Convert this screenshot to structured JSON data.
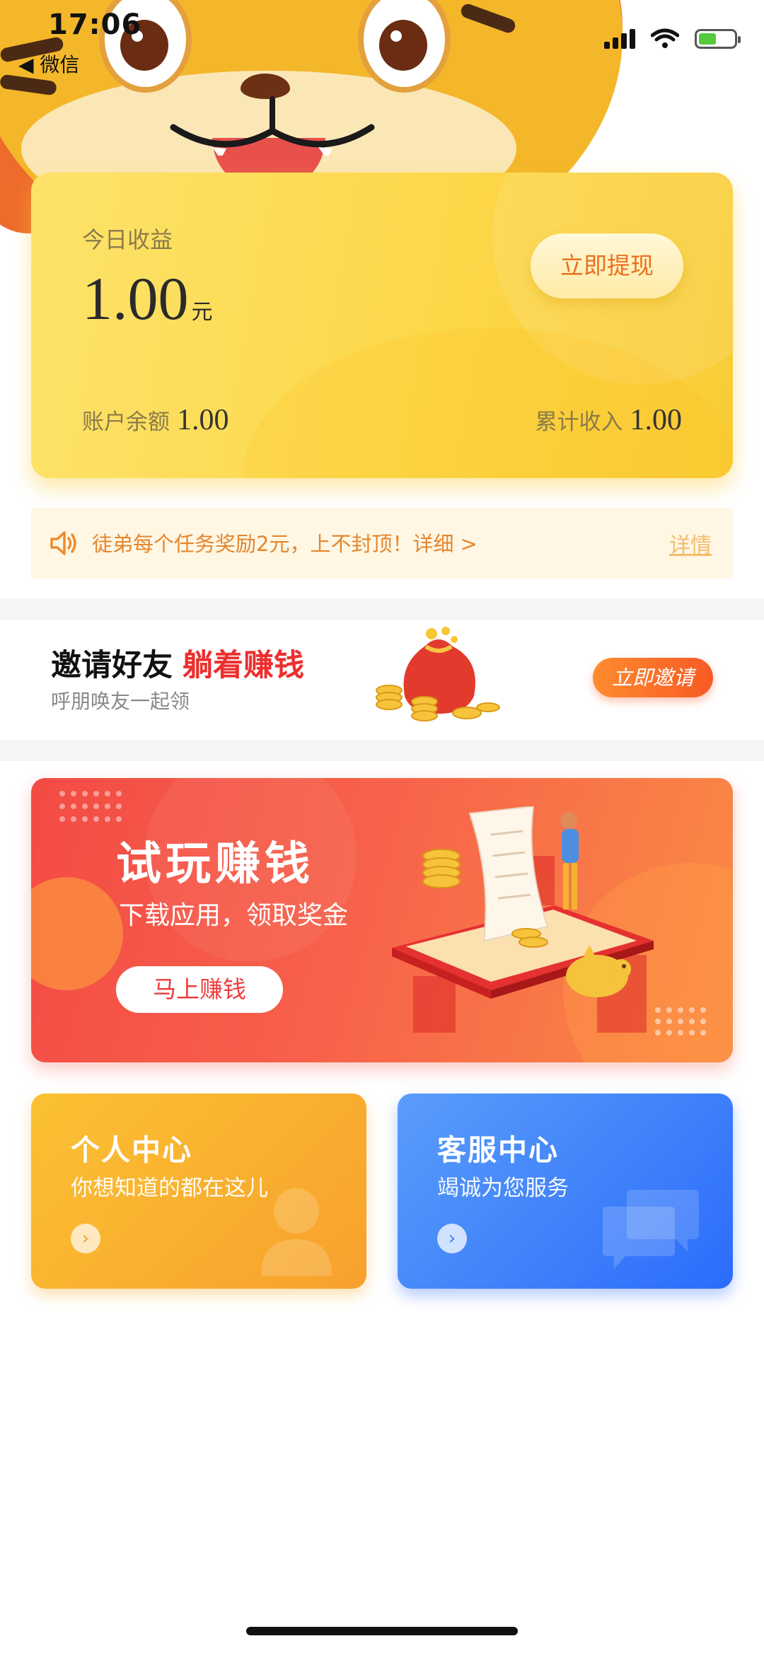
{
  "status_bar": {
    "time": "17:06",
    "back_label": "◀ 微信"
  },
  "earnings": {
    "today_label": "今日收益",
    "today_amount": "1.00",
    "currency_unit": "元",
    "withdraw_button": "立即提现",
    "balance_label": "账户余额",
    "balance_value": "1.00",
    "total_label": "累计收入",
    "total_value": "1.00"
  },
  "notice": {
    "icon": "speaker-icon",
    "text": "徒弟每个任务奖励2元，上不封顶！详细 >",
    "link": "详情"
  },
  "invite": {
    "title": "邀请好友",
    "highlight": "躺着赚钱",
    "subtitle": "呼朋唤友一起领",
    "button": "立即邀请"
  },
  "trial": {
    "title": "试玩赚钱",
    "subtitle": "下载应用，领取奖金",
    "button": "马上赚钱"
  },
  "personal_center": {
    "title": "个人中心",
    "subtitle": "你想知道的都在这儿",
    "icon": "user-icon"
  },
  "service_center": {
    "title": "客服中心",
    "subtitle": "竭诚为您服务",
    "icon": "chat-bubbles-icon"
  },
  "colors": {
    "accent_yellow": "#fcd84a",
    "accent_red": "#ed2f2f",
    "accent_orange": "#f75a24",
    "accent_blue": "#2b6cfb"
  }
}
